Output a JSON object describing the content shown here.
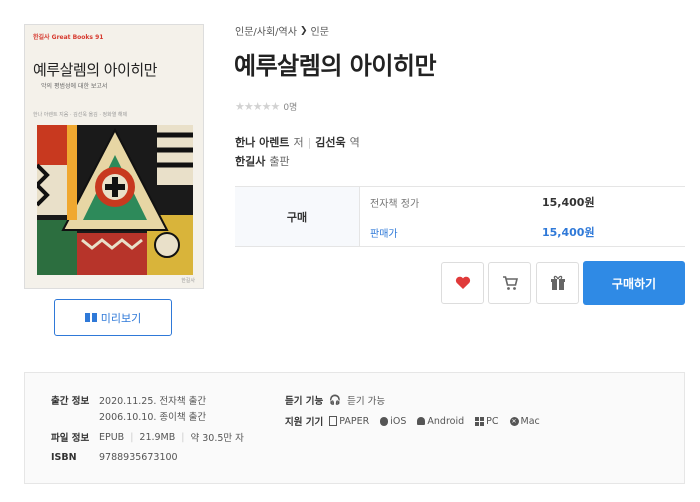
{
  "cover": {
    "series": "한길사 Great Books 91",
    "title": "예루살렘의 아이히만",
    "subtitle": "악의 평범성에 대한 보고서",
    "credits": "한나 아렌트 지음 · 김선욱 옮김 · 정화열 해제",
    "publisher": "한길사"
  },
  "preview_label": "미리보기",
  "breadcrumb": {
    "first": "인문/사회/역사",
    "sep": "❯",
    "second": "인문"
  },
  "title": "예루살렘의 아이히만",
  "rating": {
    "stars": "★★★★★",
    "count": "0명"
  },
  "authors": {
    "author": "한나 아렌트",
    "author_role": "저",
    "translator": "김선욱",
    "translator_role": "역"
  },
  "publisher": {
    "name": "한길사",
    "role": "출판"
  },
  "price": {
    "label": "구매",
    "ebook_label": "전자책 정가",
    "ebook_price": "15,400원",
    "sale_label": "판매가",
    "sale_price": "15,400원"
  },
  "buy_label": "구매하기",
  "info": {
    "release_label": "출간 정보",
    "release_ebook": "2020.11.25. 전자책 출간",
    "release_paper": "2006.10.10. 종이책 출간",
    "file_label": "파일 정보",
    "file_format": "EPUB",
    "file_size": "21.9MB",
    "file_chars": "약 30.5만 자",
    "isbn_label": "ISBN",
    "isbn": "9788935673100",
    "listen_label": "듣기 기능",
    "listen_value": "듣기 가능",
    "device_label": "지원 기기",
    "devices": [
      "PAPER",
      "iOS",
      "Android",
      "PC",
      "Mac"
    ]
  },
  "colors": {
    "accent": "#2f8ae5",
    "heart": "#e03a3a"
  }
}
